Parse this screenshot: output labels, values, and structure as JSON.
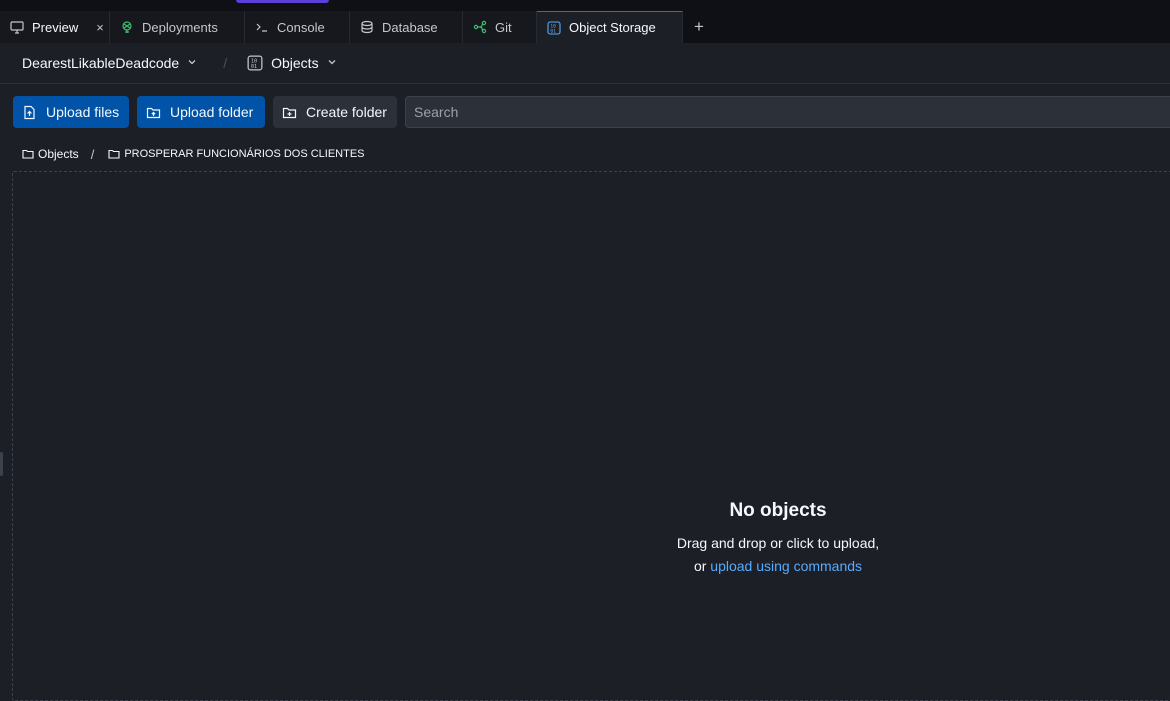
{
  "tabs": [
    {
      "label": "Preview",
      "icon": "monitor-icon",
      "closable": true
    },
    {
      "label": "Deployments",
      "icon": "deployments-icon"
    },
    {
      "label": "Console",
      "icon": "terminal-icon"
    },
    {
      "label": "Database",
      "icon": "database-icon"
    },
    {
      "label": "Git",
      "icon": "git-icon"
    },
    {
      "label": "Object Storage",
      "icon": "object-storage-icon",
      "active": true
    }
  ],
  "tab_close_glyph": "×",
  "tab_add_glyph": "+",
  "header": {
    "repl_name": "DearestLikableDeadcode",
    "separator": "/",
    "section": "Objects"
  },
  "toolbar": {
    "upload_files": "Upload files",
    "upload_folder": "Upload folder",
    "create_folder": "Create folder",
    "search_placeholder": "Search"
  },
  "breadcrumb": {
    "root": "Objects",
    "separator": "/",
    "current": "PROSPERAR FUNCIONÁRIOS DOS CLIENTES"
  },
  "empty_state": {
    "title": "No objects",
    "line1": "Drag and drop or click to upload,",
    "line2_prefix": "or ",
    "line2_link": "upload using commands"
  },
  "colors": {
    "background": "#1c1f26",
    "primary_button": "#0053a6",
    "link": "#57abff",
    "active_tab_border": "#0079f2"
  }
}
